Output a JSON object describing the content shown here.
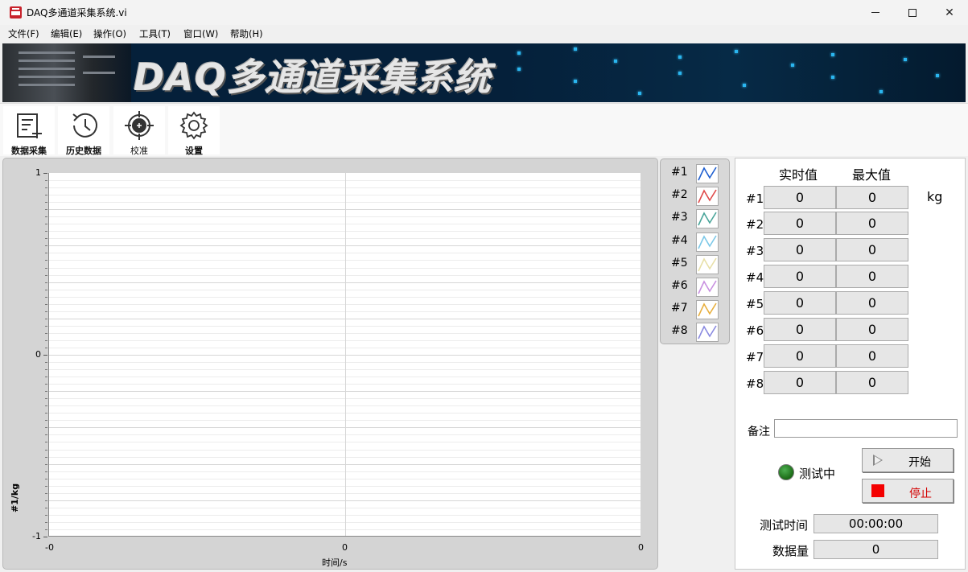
{
  "window": {
    "title": "DAQ多通道采集系统.vi"
  },
  "menu": [
    "文件(F)",
    "编辑(E)",
    "操作(O)",
    "工具(T)",
    "窗口(W)",
    "帮助(H)"
  ],
  "banner": {
    "title": "DAQ多通道采集系统"
  },
  "toolbar": [
    {
      "label": "数据采集",
      "icon": "data-acquisition-icon"
    },
    {
      "label": "历史数据",
      "icon": "history-icon"
    },
    {
      "label": "校准",
      "icon": "crosshair-icon"
    },
    {
      "label": "设置",
      "icon": "gear-icon"
    }
  ],
  "graph": {
    "ylabel": "#1/kg",
    "xlabel": "时间/s",
    "yticks": [
      "1",
      "0",
      "-1"
    ],
    "xticks": [
      "-0",
      "0",
      "0"
    ],
    "ylim": [
      -1,
      1
    ]
  },
  "legend": [
    {
      "name": "#1",
      "color": "#1f5fd0"
    },
    {
      "name": "#2",
      "color": "#e04a4a"
    },
    {
      "name": "#3",
      "color": "#4aa59a"
    },
    {
      "name": "#4",
      "color": "#7cc8e8"
    },
    {
      "name": "#5",
      "color": "#e8e0a8"
    },
    {
      "name": "#6",
      "color": "#c890e0"
    },
    {
      "name": "#7",
      "color": "#e8b040"
    },
    {
      "name": "#8",
      "color": "#8a8ae0"
    }
  ],
  "readings": {
    "realtime_header": "实时值",
    "max_header": "最大值",
    "unit": "kg",
    "channels": [
      {
        "name": "#1",
        "realtime": "0",
        "max": "0"
      },
      {
        "name": "#2",
        "realtime": "0",
        "max": "0"
      },
      {
        "name": "#3",
        "realtime": "0",
        "max": "0"
      },
      {
        "name": "#4",
        "realtime": "0",
        "max": "0"
      },
      {
        "name": "#5",
        "realtime": "0",
        "max": "0"
      },
      {
        "name": "#6",
        "realtime": "0",
        "max": "0"
      },
      {
        "name": "#7",
        "realtime": "0",
        "max": "0"
      },
      {
        "name": "#8",
        "realtime": "0",
        "max": "0"
      }
    ]
  },
  "note": {
    "label": "备注",
    "value": ""
  },
  "status": {
    "text": "测试中",
    "led_color": "#2e8b2e"
  },
  "buttons": {
    "start": "开始",
    "stop": "停止"
  },
  "info": {
    "time_label": "测试时间",
    "time_value": "00:00:00",
    "count_label": "数据量",
    "count_value": "0"
  }
}
